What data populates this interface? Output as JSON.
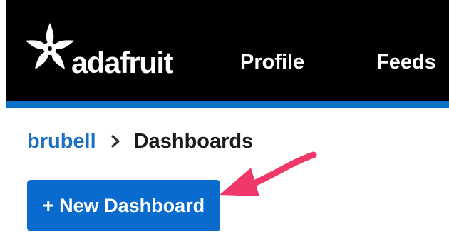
{
  "header": {
    "logo_text": "adafruit",
    "logo_icon": "adafruit-star-flower-icon",
    "nav": [
      {
        "label": "Profile"
      },
      {
        "label": "Feeds"
      }
    ],
    "background_color": "#000000",
    "accent_color": "#0a70c8"
  },
  "breadcrumb": {
    "user": "brubell",
    "separator_icon": "chevron-right-icon",
    "current": "Dashboards"
  },
  "actions": {
    "new_dashboard_label": "+ New Dashboard",
    "button_color": "#0a6bcf"
  },
  "annotation": {
    "arrow_icon": "pointer-arrow-icon",
    "arrow_color": "#f0386b"
  }
}
